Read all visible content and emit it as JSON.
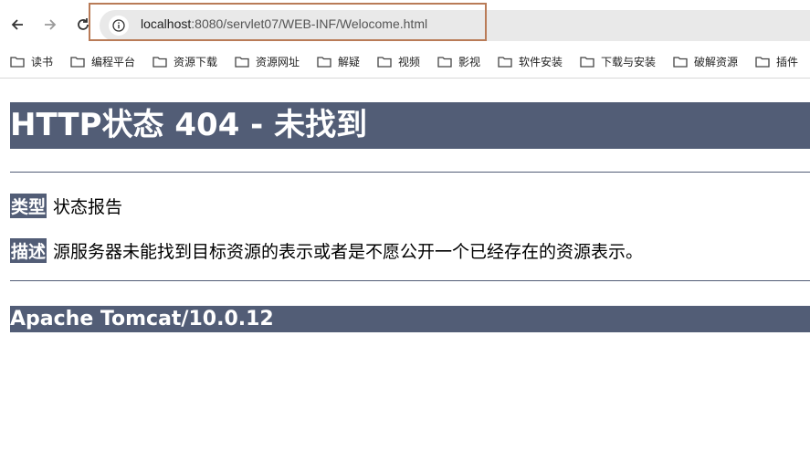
{
  "browser": {
    "url_host": "localhost",
    "url_path": ":8080/servlet07/WEB-INF/Welocome.html"
  },
  "bookmarks": [
    {
      "label": "读书"
    },
    {
      "label": "编程平台"
    },
    {
      "label": "资源下载"
    },
    {
      "label": "资源网址"
    },
    {
      "label": "解疑"
    },
    {
      "label": "视频"
    },
    {
      "label": "影视"
    },
    {
      "label": "软件安装"
    },
    {
      "label": "下载与安装"
    },
    {
      "label": "破解资源"
    },
    {
      "label": "插件"
    }
  ],
  "page": {
    "title": "HTTP状态 404 - 未找到",
    "type_label": "类型",
    "type_value": "状态报告",
    "desc_label": "描述",
    "desc_value": "源服务器未能找到目标资源的表示或者是不愿公开一个已经存在的资源表示。",
    "server": "Apache Tomcat/10.0.12"
  },
  "colors": {
    "tomcat_header_bg": "#525d76",
    "url_highlight_border": "#b97b57"
  }
}
